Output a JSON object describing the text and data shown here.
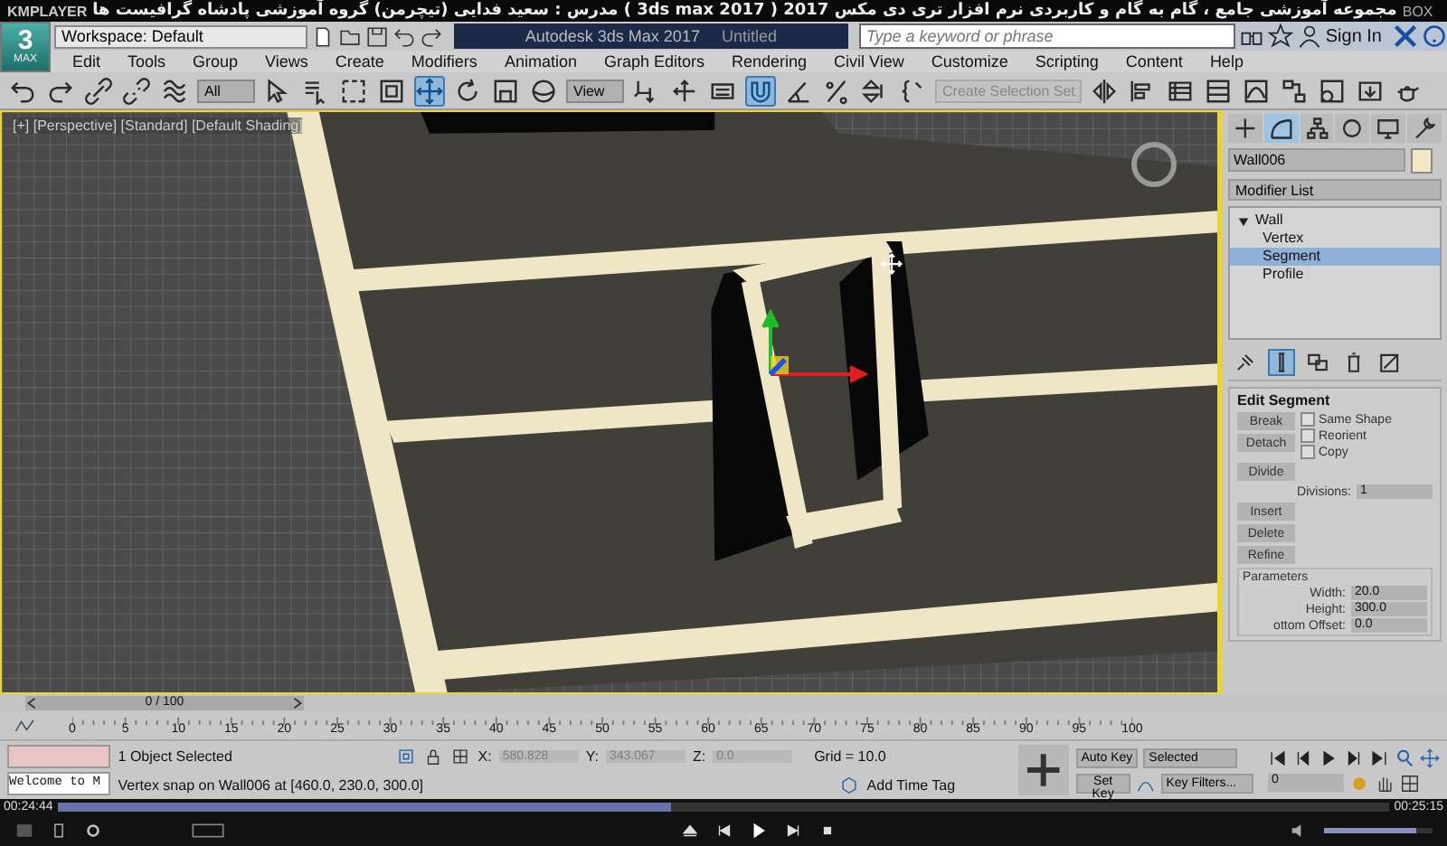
{
  "player": {
    "brand": "KMPLAYER",
    "title": "مجموعه آموزشی جامع ، گام به گام و کاربردی نرم افزار تری دی مکس 2017  ( 3ds max 2017 )  مدرس : سعید فدایی (تیچرمن) گروه آموزشی پادشاه گرافیست ها",
    "box": "BOX",
    "elapsed": "00:24:44",
    "duration": "00:25:15",
    "progress": {
      "level": 0.46
    },
    "volume": {
      "level": 0.85
    }
  },
  "app": {
    "logo_number": "3",
    "logo_label": "MAX",
    "workspace": "Workspace: Default",
    "title": "Autodesk 3ds Max 2017",
    "document": "Untitled",
    "search": {
      "placeholder": "Type a keyword or phrase"
    },
    "sign_in": "Sign In"
  },
  "menu": [
    "Edit",
    "Tools",
    "Group",
    "Views",
    "Create",
    "Modifiers",
    "Animation",
    "Graph Editors",
    "Rendering",
    "Civil View",
    "Customize",
    "Scripting",
    "Content",
    "Help"
  ],
  "toolbar": [
    {
      "kind": "undo",
      "selected": false,
      "disabled": false
    },
    {
      "kind": "redo",
      "selected": false,
      "disabled": false
    },
    {
      "kind": "chain-link",
      "selected": false,
      "disabled": false
    },
    {
      "kind": "broken-link",
      "selected": false,
      "disabled": false
    },
    {
      "kind": "wave",
      "selected": false,
      "disabled": false
    },
    {
      "kind": "dropdown",
      "label": "All",
      "selected": false,
      "disabled": false
    },
    {
      "kind": "arrow-cursor",
      "selected": false,
      "disabled": false
    },
    {
      "kind": "list-cursor",
      "selected": false,
      "disabled": false
    },
    {
      "kind": "dashed-square",
      "selected": false,
      "disabled": false
    },
    {
      "kind": "window-square",
      "selected": false,
      "disabled": false
    },
    {
      "kind": "move-arrows",
      "selected": true,
      "disabled": false
    },
    {
      "kind": "rotate",
      "selected": false,
      "disabled": false
    },
    {
      "kind": "scale-square",
      "selected": false,
      "disabled": false
    },
    {
      "kind": "sphere",
      "selected": false,
      "disabled": false
    },
    {
      "kind": "dropdown",
      "label": "View",
      "selected": false,
      "disabled": false
    },
    {
      "kind": "pivot",
      "selected": false,
      "disabled": false
    },
    {
      "kind": "cross-arrows",
      "selected": false,
      "disabled": false
    },
    {
      "kind": "keyboard",
      "selected": false,
      "disabled": false
    },
    {
      "kind": "snap-magnet",
      "selected": true,
      "disabled": false
    },
    {
      "kind": "angle",
      "selected": false,
      "disabled": false
    },
    {
      "kind": "percent",
      "selected": false,
      "disabled": false
    },
    {
      "kind": "spinner",
      "selected": false,
      "disabled": false
    },
    {
      "kind": "braces",
      "selected": false,
      "disabled": false
    },
    {
      "kind": "dropdown",
      "label": "Create Selection Set",
      "selected": false,
      "disabled": true
    },
    {
      "kind": "mirror",
      "selected": false,
      "disabled": false
    },
    {
      "kind": "align",
      "selected": false,
      "disabled": false
    },
    {
      "kind": "layers",
      "selected": false,
      "disabled": false
    },
    {
      "kind": "grid-table",
      "selected": false,
      "disabled": false
    },
    {
      "kind": "curve",
      "selected": false,
      "disabled": false
    },
    {
      "kind": "schematic",
      "selected": false,
      "disabled": false
    },
    {
      "kind": "material",
      "selected": false,
      "disabled": false
    },
    {
      "kind": "render-frame",
      "selected": false,
      "disabled": false
    },
    {
      "kind": "teapot",
      "selected": false,
      "disabled": false
    }
  ],
  "viewport": {
    "label": "[+] [Perspective] [Standard] [Default Shading]"
  },
  "command_panel": {
    "tabs": [
      {
        "kind": "plus",
        "selected": false
      },
      {
        "kind": "bend",
        "selected": true
      },
      {
        "kind": "hierarchy",
        "selected": false
      },
      {
        "kind": "circle",
        "selected": false
      },
      {
        "kind": "monitor",
        "selected": false
      },
      {
        "kind": "wrench",
        "selected": false
      }
    ],
    "object_name": "Wall006",
    "modifier_list": "Modifier List",
    "stack": [
      {
        "label": "Wall",
        "expanded": true,
        "selected": false,
        "children": [
          {
            "label": "Vertex",
            "selected": false
          },
          {
            "label": "Segment",
            "selected": true
          },
          {
            "label": "Profile",
            "selected": false
          }
        ]
      }
    ],
    "stack_tools": [
      {
        "kind": "pin",
        "selected": false
      },
      {
        "kind": "end-result",
        "selected": true
      },
      {
        "kind": "make-unique",
        "selected": false
      },
      {
        "kind": "trash",
        "selected": false
      },
      {
        "kind": "configure",
        "selected": false
      }
    ],
    "rollout": {
      "title": "Edit Segment",
      "break": "Break",
      "detach": "Detach",
      "options": [
        {
          "label": "Same Shape",
          "checked": false
        },
        {
          "label": "Reorient",
          "checked": false
        },
        {
          "label": "Copy",
          "checked": false
        }
      ],
      "divide": "Divide",
      "divisions": {
        "label": "Divisions:",
        "value": "1"
      },
      "insert": "Insert",
      "delete": "Delete",
      "refine": "Refine",
      "parameters": {
        "title": "Parameters",
        "fields": [
          {
            "label": "Width:",
            "value": "20.0"
          },
          {
            "label": "Height:",
            "value": "300.0"
          },
          {
            "label": "ottom Offset:",
            "value": "0.0"
          }
        ]
      }
    }
  },
  "timeline": {
    "position": "0 / 100",
    "slider": {
      "level": 0
    },
    "ticks": [
      "0",
      "5",
      "10",
      "15",
      "20",
      "25",
      "30",
      "35",
      "40",
      "45",
      "50",
      "55",
      "60",
      "65",
      "70",
      "75",
      "80",
      "85",
      "90",
      "95",
      "100"
    ]
  },
  "status": {
    "maxscript": "Welcome to M",
    "selection": "1 Object Selected",
    "prompt": "Vertex snap on Wall006 at [460.0, 230.0, 300.0]",
    "coords": [
      {
        "label": "X:",
        "value": "580.828",
        "disabled": true
      },
      {
        "label": "Y:",
        "value": "343.067",
        "disabled": true
      },
      {
        "label": "Z:",
        "value": "0.0",
        "disabled": true
      }
    ],
    "grid": "Grid = 10.0",
    "time_tag": "Add Time Tag",
    "auto_key": "Auto Key",
    "key_mode": "Selected",
    "set_key": "Set Key",
    "key_filters": "Key Filters...",
    "frame": "0"
  }
}
